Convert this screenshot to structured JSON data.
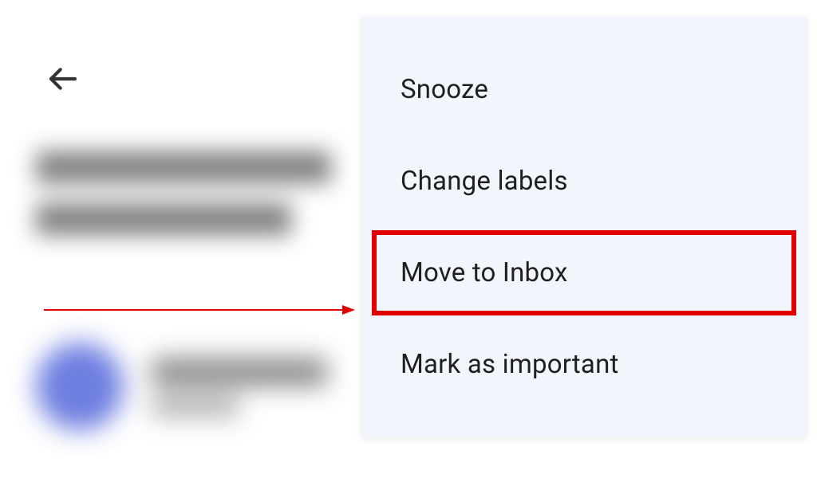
{
  "menu": {
    "items": [
      {
        "label": "Snooze"
      },
      {
        "label": "Change labels"
      },
      {
        "label": "Move to Inbox"
      },
      {
        "label": "Mark as important"
      }
    ]
  },
  "annotation": {
    "arrow_color": "#e00000",
    "highlight_color": "#e00000"
  }
}
